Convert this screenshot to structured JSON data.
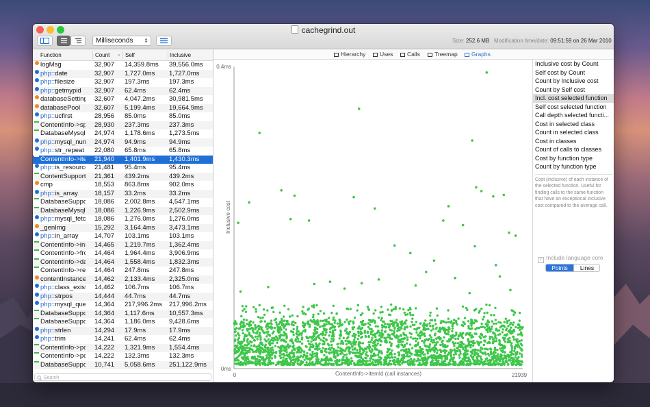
{
  "window": {
    "title": "cachegrind.out",
    "size_label": "Size:",
    "size_value": "252.6 MB",
    "mtime_label": "Modification time/date:",
    "mtime_value": "09:51:59 on 26 Mar 2010"
  },
  "toolbar": {
    "unit": "Milliseconds"
  },
  "table": {
    "headers": {
      "function": "Function",
      "count": "Count",
      "self": "Self",
      "inclusive": "Inclusive"
    },
    "rows": [
      {
        "kind": "dot",
        "color": "#f08a24",
        "prefix": "",
        "name": "logMsg",
        "count": "32,907",
        "self": "14,359.8ms",
        "inclusive": "39,556.0ms"
      },
      {
        "kind": "dot",
        "color": "#1f6fd6",
        "prefix": "php::",
        "name": "date",
        "count": "32,907",
        "self": "1,727.0ms",
        "inclusive": "1,727.0ms"
      },
      {
        "kind": "dot",
        "color": "#1f6fd6",
        "prefix": "php::",
        "name": "filesize",
        "count": "32,907",
        "self": "197.3ms",
        "inclusive": "197.3ms"
      },
      {
        "kind": "dot",
        "color": "#1f6fd6",
        "prefix": "php::",
        "name": "getmypid",
        "count": "32,907",
        "self": "62.4ms",
        "inclusive": "62.4ms"
      },
      {
        "kind": "dot",
        "color": "#f08a24",
        "prefix": "",
        "name": "databaseSetting",
        "count": "32,607",
        "self": "4,047.2ms",
        "inclusive": "30,981.5ms"
      },
      {
        "kind": "dot",
        "color": "#f08a24",
        "prefix": "",
        "name": "databasePool",
        "count": "32,607",
        "self": "5,199.4ms",
        "inclusive": "19,664.9ms"
      },
      {
        "kind": "dot",
        "color": "#1f6fd6",
        "prefix": "php::",
        "name": "ucfirst",
        "count": "28,956",
        "self": "85.0ms",
        "inclusive": "85.0ms"
      },
      {
        "kind": "arrow",
        "color": "",
        "prefix": "",
        "name": "ContentInfo->spec",
        "count": "28,930",
        "self": "237.3ms",
        "inclusive": "237.3ms"
      },
      {
        "kind": "arrow",
        "color": "",
        "prefix": "",
        "name": "DatabaseMysql->n",
        "count": "24,974",
        "self": "1,178.6ms",
        "inclusive": "1,273.5ms"
      },
      {
        "kind": "dot",
        "color": "#1f6fd6",
        "prefix": "php::",
        "name": "mysql_num_rc",
        "count": "24,974",
        "self": "94.9ms",
        "inclusive": "94.9ms"
      },
      {
        "kind": "dot",
        "color": "#1f6fd6",
        "prefix": "php::",
        "name": "str_repeat",
        "count": "22,080",
        "self": "65.8ms",
        "inclusive": "65.8ms"
      },
      {
        "kind": "arrow",
        "color": "",
        "prefix": "",
        "name": "ContentInfo->itemI",
        "count": "21,940",
        "self": "1,401.9ms",
        "inclusive": "1,430.3ms",
        "selected": true
      },
      {
        "kind": "dot",
        "color": "#1f6fd6",
        "prefix": "php::",
        "name": "is_resource",
        "count": "21,481",
        "self": "95.4ms",
        "inclusive": "95.4ms"
      },
      {
        "kind": "arrow",
        "color": "",
        "prefix": "",
        "name": "ContentSupport->c",
        "count": "21,361",
        "self": "439.2ms",
        "inclusive": "439.2ms"
      },
      {
        "kind": "dot",
        "color": "#f08a24",
        "prefix": "",
        "name": "cmp",
        "count": "18,553",
        "self": "863.8ms",
        "inclusive": "902.0ms"
      },
      {
        "kind": "dot",
        "color": "#1f6fd6",
        "prefix": "php::",
        "name": "is_array",
        "count": "18,157",
        "self": "33.2ms",
        "inclusive": "33.2ms"
      },
      {
        "kind": "arrow",
        "color": "",
        "prefix": "",
        "name": "DatabaseSupport-:",
        "count": "18,086",
        "self": "2,002.8ms",
        "inclusive": "4,547.1ms"
      },
      {
        "kind": "arrow",
        "color": "",
        "prefix": "",
        "name": "DatabaseMysql->p",
        "count": "18,086",
        "self": "1,226.9ms",
        "inclusive": "2,502.9ms"
      },
      {
        "kind": "dot",
        "color": "#1f6fd6",
        "prefix": "php::",
        "name": "mysql_fetch_a",
        "count": "18,086",
        "self": "1,276.0ms",
        "inclusive": "1,276.0ms"
      },
      {
        "kind": "dot",
        "color": "#f08a24",
        "prefix": "",
        "name": "_genImg",
        "count": "15,292",
        "self": "3,164.4ms",
        "inclusive": "3,473.1ms"
      },
      {
        "kind": "dot",
        "color": "#1f6fd6",
        "prefix": "php::",
        "name": "in_array",
        "count": "14,707",
        "self": "103.1ms",
        "inclusive": "103.1ms"
      },
      {
        "kind": "arrow",
        "color": "",
        "prefix": "",
        "name": "ContentInfo->initia",
        "count": "14,465",
        "self": "1,219.7ms",
        "inclusive": "1,362.4ms"
      },
      {
        "kind": "arrow",
        "color": "",
        "prefix": "",
        "name": "ContentInfo->from",
        "count": "14,464",
        "self": "1,964.4ms",
        "inclusive": "3,906.9ms"
      },
      {
        "kind": "arrow",
        "color": "",
        "prefix": "",
        "name": "ContentInfo->datal",
        "count": "14,464",
        "self": "1,558.4ms",
        "inclusive": "1,832.3ms"
      },
      {
        "kind": "arrow",
        "color": "",
        "prefix": "",
        "name": "ContentInfo->reset",
        "count": "14,464",
        "self": "247.8ms",
        "inclusive": "247.8ms"
      },
      {
        "kind": "dot",
        "color": "#f08a24",
        "prefix": "",
        "name": "contentInstanceCla",
        "count": "14,462",
        "self": "2,133.4ms",
        "inclusive": "2,325.0ms"
      },
      {
        "kind": "dot",
        "color": "#1f6fd6",
        "prefix": "php::",
        "name": "class_exists",
        "count": "14,462",
        "self": "106.7ms",
        "inclusive": "106.7ms"
      },
      {
        "kind": "dot",
        "color": "#1f6fd6",
        "prefix": "php::",
        "name": "strpos",
        "count": "14,444",
        "self": "44.7ms",
        "inclusive": "44.7ms"
      },
      {
        "kind": "dot",
        "color": "#1f6fd6",
        "prefix": "php::",
        "name": "mysql_query",
        "count": "14,364",
        "self": "217,996.2ms",
        "inclusive": "217,996.2ms"
      },
      {
        "kind": "arrow",
        "color": "",
        "prefix": "",
        "name": "DatabaseSupport-:",
        "count": "14,364",
        "self": "1,117.6ms",
        "inclusive": "10,557.3ms"
      },
      {
        "kind": "arrow",
        "color": "",
        "prefix": "",
        "name": "DatabaseSupport-:",
        "count": "14,364",
        "self": "1,186.0ms",
        "inclusive": "9,428.6ms"
      },
      {
        "kind": "dot",
        "color": "#1f6fd6",
        "prefix": "php::",
        "name": "strlen",
        "count": "14,294",
        "self": "17.9ms",
        "inclusive": "17.9ms"
      },
      {
        "kind": "dot",
        "color": "#1f6fd6",
        "prefix": "php::",
        "name": "trim",
        "count": "14,241",
        "self": "62.4ms",
        "inclusive": "62.4ms"
      },
      {
        "kind": "arrow",
        "color": "",
        "prefix": "",
        "name": "ContentInfo->pclVa",
        "count": "14,222",
        "self": "1,321.9ms",
        "inclusive": "1,554.4ms"
      },
      {
        "kind": "arrow",
        "color": "",
        "prefix": "",
        "name": "ContentInfo->pclTy",
        "count": "14,222",
        "self": "132.3ms",
        "inclusive": "132.3ms"
      },
      {
        "kind": "arrow",
        "color": "",
        "prefix": "",
        "name": "DatabaseSupport-:",
        "count": "10,741",
        "self": "5,058.6ms",
        "inclusive": "251,122.9ms"
      }
    ],
    "search_placeholder": "Search"
  },
  "tabs": [
    {
      "label": "Hierarchy",
      "active": false
    },
    {
      "label": "Uses",
      "active": false
    },
    {
      "label": "Calls",
      "active": false
    },
    {
      "label": "Treemap",
      "active": false
    },
    {
      "label": "Graphs",
      "active": true
    }
  ],
  "graph_options": {
    "items": [
      "Inclusive cost by Count",
      "Self cost by Count",
      "Count by Inclusive cost",
      "Count by Self cost",
      "Incl. cost selected function",
      "Self cost selected function",
      "Call depth selected functi...",
      "Cost in selected class",
      "Count in selected class",
      "Cost in classes",
      "Count of calls to classes",
      "Cost by function type",
      "Count by function type"
    ],
    "selected_index": 4,
    "description": "Cost (inclusive) of each instance of the selected function. Useful for finding calls to the same function that have an exceptional inclusive cost compared to the average call.",
    "include_core_label": "Include language core",
    "mode_points": "Points",
    "mode_lines": "Lines",
    "mode_selected": "Points"
  },
  "chart_data": {
    "type": "scatter",
    "title": "",
    "xlabel": "ContentInfo->itemId (call instances)",
    "ylabel": "Inclusive cost",
    "xlim": [
      0,
      21939
    ],
    "ylim": [
      0,
      0.4
    ],
    "y_unit": "ms",
    "y_tick_labels": [
      "0.4ms",
      "0ms"
    ],
    "x_tick_labels": [
      "0",
      "21939"
    ],
    "point_color": "#3ec64a",
    "bulk_band": {
      "y_min": 0.005,
      "y_max": 0.085,
      "note": "dense cluster of ~21,940 instances"
    },
    "outliers": [
      {
        "x": 19200,
        "y": 0.392
      },
      {
        "x": 9500,
        "y": 0.344
      },
      {
        "x": 1940,
        "y": 0.312
      },
      {
        "x": 18100,
        "y": 0.302
      },
      {
        "x": 3600,
        "y": 0.236
      },
      {
        "x": 4600,
        "y": 0.229
      },
      {
        "x": 1150,
        "y": 0.22
      },
      {
        "x": 9100,
        "y": 0.227
      },
      {
        "x": 10700,
        "y": 0.212
      },
      {
        "x": 4300,
        "y": 0.198
      },
      {
        "x": 5700,
        "y": 0.196
      },
      {
        "x": 320,
        "y": 0.193
      },
      {
        "x": 17400,
        "y": 0.19
      },
      {
        "x": 16300,
        "y": 0.215
      },
      {
        "x": 18800,
        "y": 0.235
      },
      {
        "x": 18400,
        "y": 0.24
      },
      {
        "x": 19700,
        "y": 0.228
      },
      {
        "x": 20500,
        "y": 0.23
      },
      {
        "x": 21400,
        "y": 0.176
      },
      {
        "x": 20900,
        "y": 0.18
      },
      {
        "x": 12200,
        "y": 0.163
      },
      {
        "x": 13400,
        "y": 0.153
      },
      {
        "x": 16800,
        "y": 0.12
      },
      {
        "x": 15200,
        "y": 0.143
      },
      {
        "x": 14600,
        "y": 0.128
      },
      {
        "x": 15900,
        "y": 0.196
      },
      {
        "x": 18300,
        "y": 0.162
      },
      {
        "x": 19900,
        "y": 0.137
      },
      {
        "x": 20200,
        "y": 0.122
      },
      {
        "x": 11000,
        "y": 0.118
      },
      {
        "x": 9700,
        "y": 0.113
      },
      {
        "x": 6100,
        "y": 0.112
      },
      {
        "x": 7300,
        "y": 0.115
      },
      {
        "x": 8400,
        "y": 0.106
      },
      {
        "x": 2600,
        "y": 0.108
      },
      {
        "x": 13800,
        "y": 0.11
      },
      {
        "x": 17900,
        "y": 0.1
      },
      {
        "x": 21000,
        "y": 0.104
      },
      {
        "x": 500,
        "y": 0.102
      }
    ]
  }
}
